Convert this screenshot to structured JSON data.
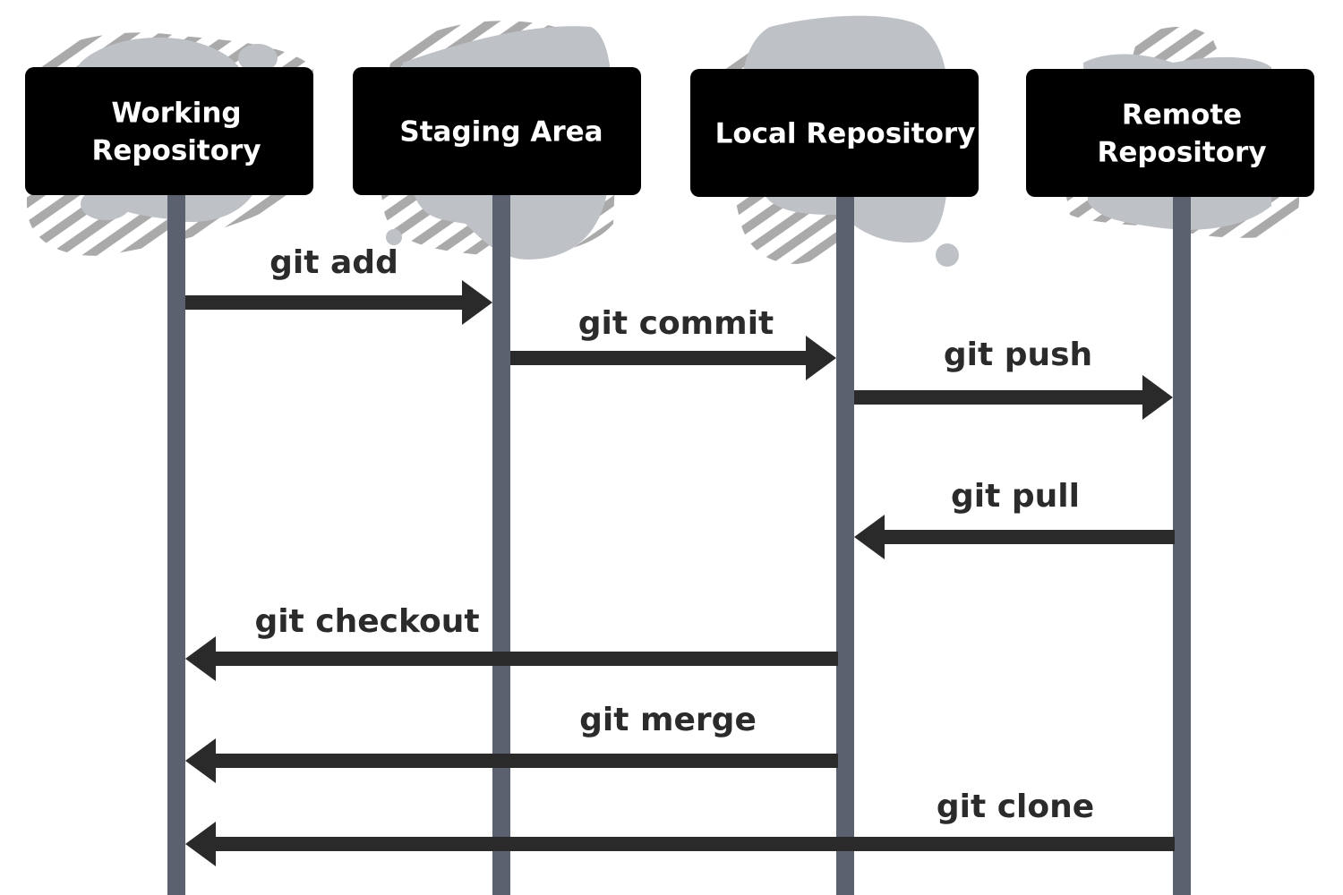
{
  "diagram": {
    "type": "sequence",
    "colors": {
      "box": "#000000",
      "box_text": "#ffffff",
      "lifeline": "#5b616e",
      "arrow": "#2a2a2a",
      "label": "#2b2b2b",
      "blob": "#bec1c6",
      "stripe": "#aaaaaa"
    },
    "actors": [
      {
        "id": "working",
        "lines": [
          "Working",
          "Repository"
        ]
      },
      {
        "id": "staging",
        "lines": [
          "Staging Area"
        ]
      },
      {
        "id": "local",
        "lines": [
          "Local Repository"
        ]
      },
      {
        "id": "remote",
        "lines": [
          "Remote",
          "Repository"
        ]
      }
    ],
    "messages": [
      {
        "label": "git add",
        "from": "working",
        "to": "staging"
      },
      {
        "label": "git commit",
        "from": "staging",
        "to": "local"
      },
      {
        "label": "git push",
        "from": "local",
        "to": "remote"
      },
      {
        "label": "git pull",
        "from": "remote",
        "to": "local"
      },
      {
        "label": "git checkout",
        "from": "local",
        "to": "working"
      },
      {
        "label": "git merge",
        "from": "local",
        "to": "working"
      },
      {
        "label": "git clone",
        "from": "remote",
        "to": "working"
      }
    ]
  }
}
